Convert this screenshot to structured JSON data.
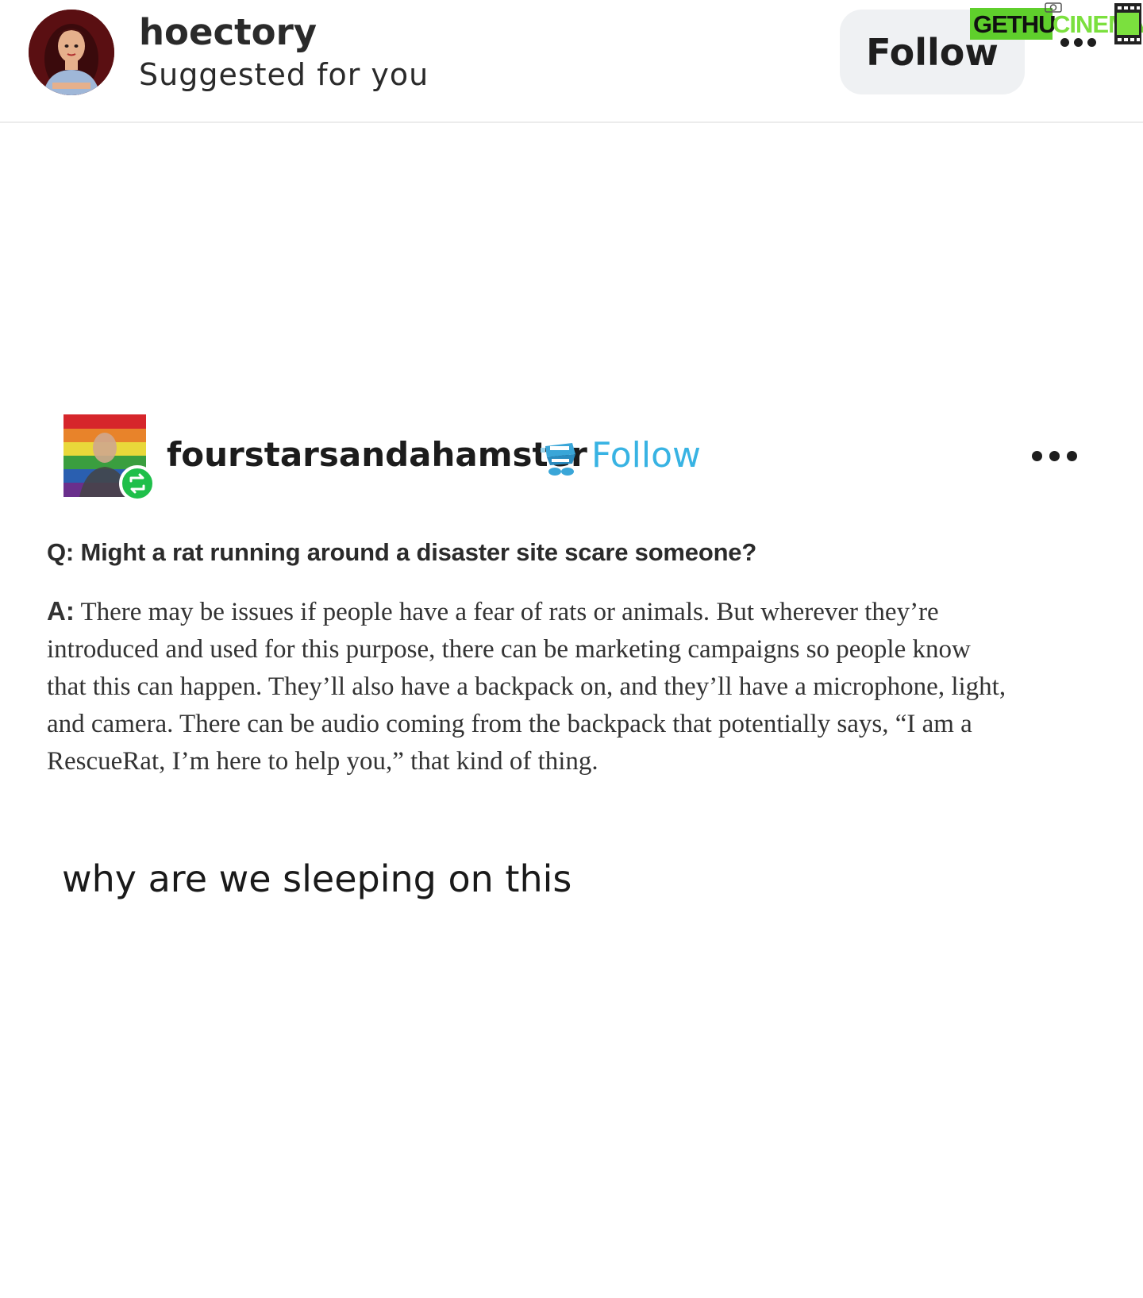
{
  "header": {
    "username": "hoectory",
    "subtitle": "Suggested for you",
    "follow_label": "Follow",
    "avatar_icon": "cartoon-princess-avatar",
    "more_icon": "more-options-icon"
  },
  "watermark": {
    "part1": "GETHU",
    "part2": "CINEMA"
  },
  "post": {
    "username": "fourstarsandahamster",
    "follow_label": "Follow",
    "badge_icon": "chattering-teeth-badge-icon",
    "reblog_icon": "reblog-icon",
    "question": "Q: Might a rat running around a disaster site scare someone?",
    "answer_label": "A:",
    "answer_lines": [
      " There may be issues if people have a fear of rats or animals. But wherever they’re",
      "introduced and used for this purpose, there can be marketing campaigns so people know",
      "that this can happen. They’ll also have a backpack on, and they’ll have a microphone, light,",
      "and camera. There can be audio coming from the backpack that potentially says, “I am a",
      "RescueRat, I’m here to help you,” that kind of thing."
    ]
  },
  "comment": "why are we sleeping on this",
  "colors": {
    "follow_blue": "#38b3e3",
    "reblog_green": "#1fbf4a",
    "watermark_green": "#5fcf2c"
  }
}
